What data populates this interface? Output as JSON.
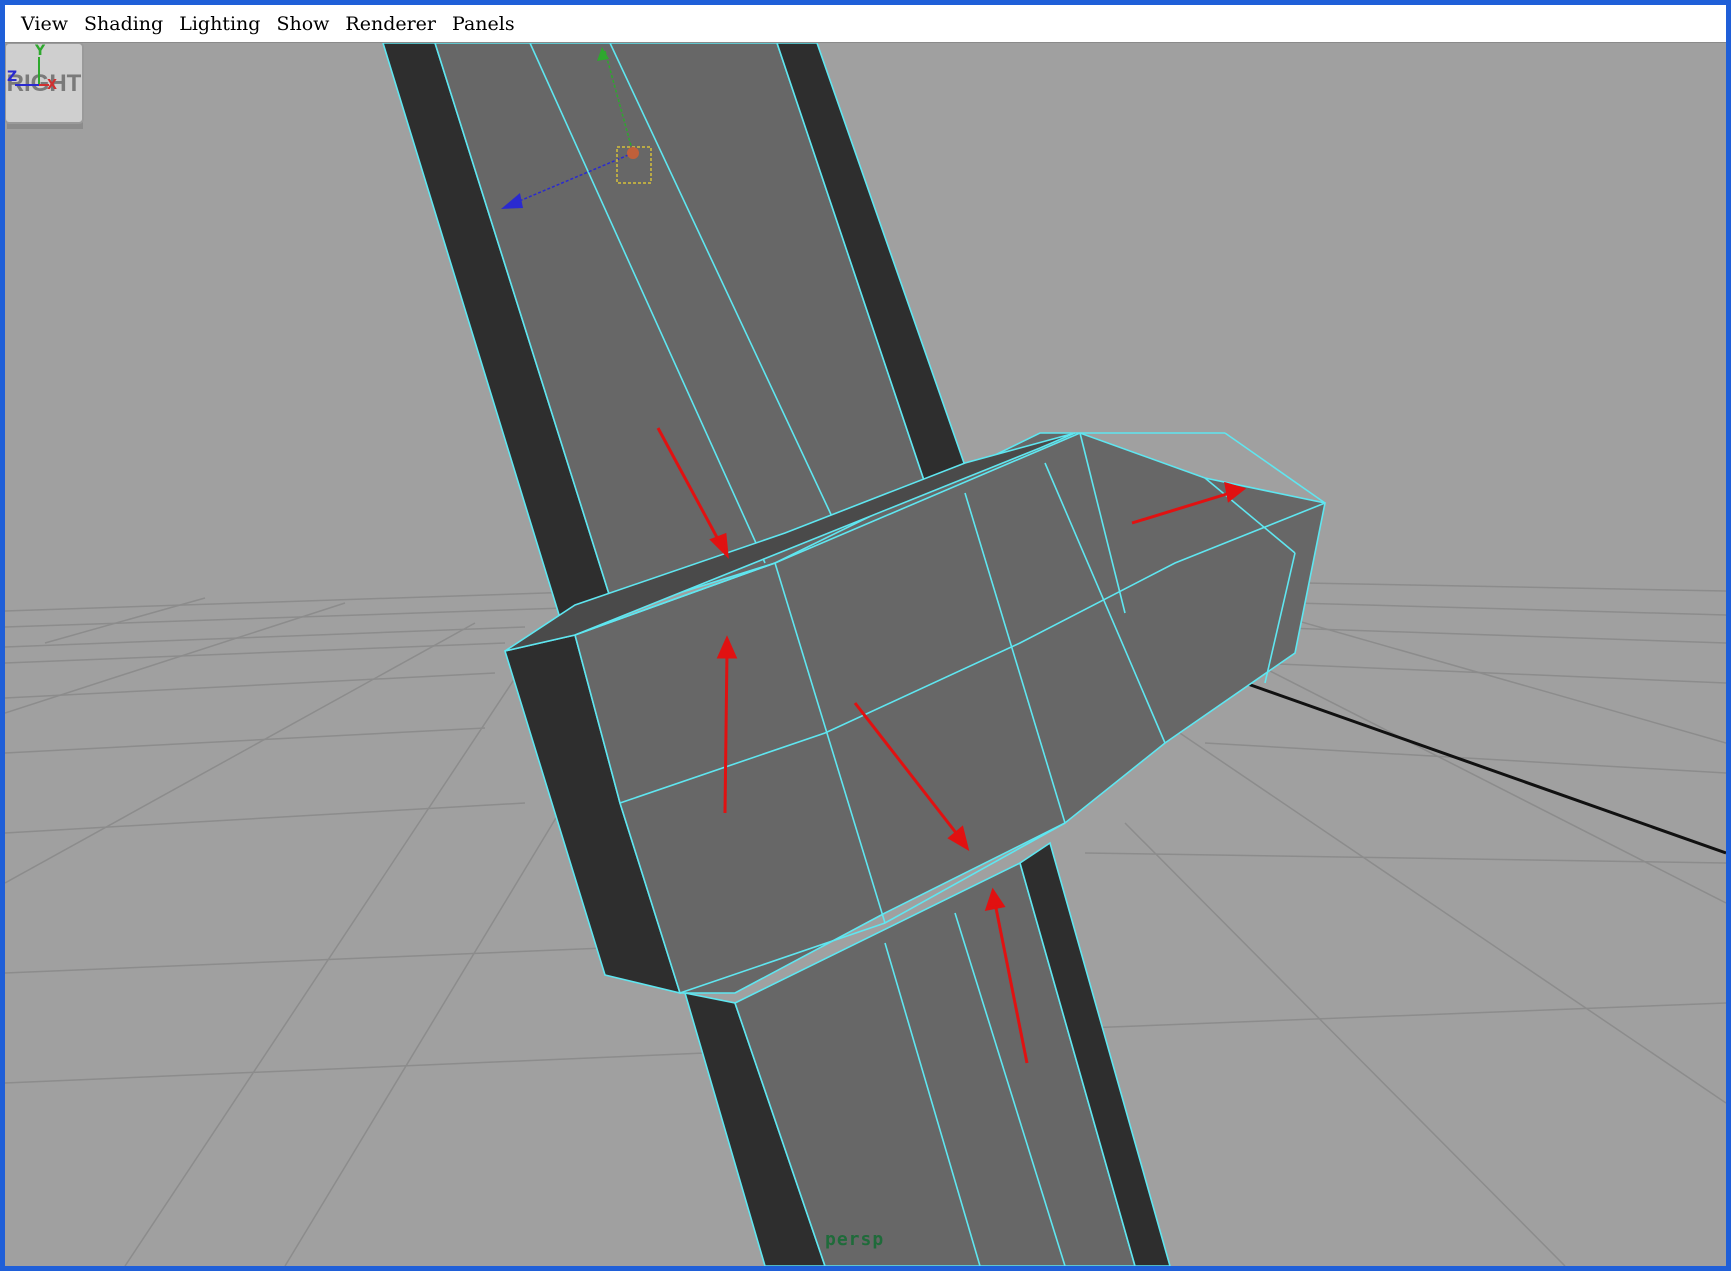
{
  "menu": {
    "items": [
      {
        "label": "View"
      },
      {
        "label": "Shading"
      },
      {
        "label": "Lighting"
      },
      {
        "label": "Show"
      },
      {
        "label": "Renderer"
      },
      {
        "label": "Panels"
      }
    ]
  },
  "viewport": {
    "camera": "persp",
    "view_cube_label": "RIGHT",
    "axis_labels": {
      "y": "Y",
      "z": "Z",
      "x": "X"
    },
    "colors": {
      "background": "#a0a0a0",
      "wireframe": "#5fe6f0",
      "mesh_face": "#676767",
      "mesh_dark": "#2e2e2e",
      "annotation_arrows": "#e11111",
      "grid": "#8c8c8c"
    }
  },
  "window": {
    "border_color": "#1f5fd8"
  }
}
